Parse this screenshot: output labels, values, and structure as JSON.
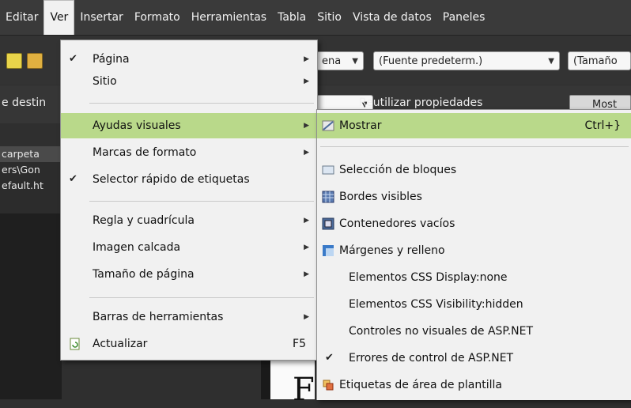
{
  "menubar": {
    "items": [
      "Editar",
      "Ver",
      "Insertar",
      "Formato",
      "Herramientas",
      "Tabla",
      "Sitio",
      "Vista de datos",
      "Paneles"
    ]
  },
  "toolbar": {
    "partial_combo": "ena",
    "font_combo": "(Fuente predeterm.)",
    "size_combo": "(Tamaño",
    "target_label": "e destin",
    "reuse_label": "Reutilizar propiedades",
    "show_button": "Most"
  },
  "left_panel": {
    "rows": [
      "carpeta",
      "ers\\Gon",
      "efault.ht"
    ]
  },
  "ver_menu": {
    "items": [
      {
        "label": "Página",
        "checked": true,
        "submenu": true
      },
      {
        "label": "Sitio",
        "checked": false,
        "submenu": true
      },
      {
        "label": "Ayudas visuales",
        "checked": false,
        "submenu": true
      },
      {
        "label": "Marcas de formato",
        "checked": false,
        "submenu": true
      },
      {
        "label": "Selector rápido de etiquetas",
        "checked": true,
        "submenu": false
      },
      {
        "label": "Regla y cuadrícula",
        "checked": false,
        "submenu": true
      },
      {
        "label": "Imagen calcada",
        "checked": false,
        "submenu": true
      },
      {
        "label": "Tamaño de página",
        "checked": false,
        "submenu": true
      },
      {
        "label": "Barras de herramientas",
        "checked": false,
        "submenu": true
      },
      {
        "label": "Actualizar",
        "checked": false,
        "submenu": false,
        "shortcut": "F5"
      }
    ]
  },
  "visual_aids_menu": {
    "items": [
      {
        "label": "Mostrar",
        "shortcut": "Ctrl+}"
      },
      {
        "label": "Selección de bloques"
      },
      {
        "label": "Bordes visibles"
      },
      {
        "label": "Contenedores vacíos"
      },
      {
        "label": "Márgenes y relleno"
      },
      {
        "label": "Elementos CSS Display:none"
      },
      {
        "label": "Elementos CSS Visibility:hidden"
      },
      {
        "label": "Controles no visuales de ASP.NET"
      },
      {
        "label": "Errores de control de ASP.NET",
        "checked": true
      },
      {
        "label": "Etiquetas de área de plantilla"
      }
    ]
  },
  "colors": {
    "highlight": "#b9d98a",
    "menu_bg": "#f1f1f1",
    "menubar_bg": "#3a3a3a"
  }
}
